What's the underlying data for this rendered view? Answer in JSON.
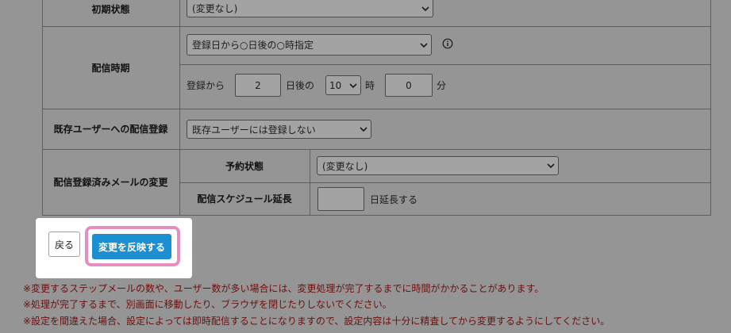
{
  "form": {
    "initial_state": {
      "label": "初期状態",
      "value": "(変更なし)"
    },
    "delivery_timing": {
      "label": "配信時期",
      "mode": "登録日から○日後の○時指定",
      "prefix": "登録から",
      "days": "2",
      "days_suffix": "日後の",
      "hour": "10",
      "hour_suffix": "時",
      "minute": "0",
      "minute_suffix": "分",
      "info_icon": "info-icon"
    },
    "existing_users": {
      "label": "既存ユーザーへの配信登録",
      "value": "既存ユーザーには登録しない"
    },
    "registered_change": {
      "label": "配信登録済みメールの変更",
      "reservation_label": "予約状態",
      "reservation_value": "(変更なし)",
      "extend_label": "配信スケジュール延長",
      "extend_value": "",
      "extend_suffix": "日延長する"
    }
  },
  "actions": {
    "back_label": "戻る",
    "apply_label": "変更を反映する"
  },
  "notes": [
    "※変更するステップメールの数や、ユーザー数が多い場合には、変更処理が完了するまでに時間がかかることがあります。",
    "※処理が完了するまで、別画面に移動したり、ブラウザを閉じたりしないでください。",
    "※設定を間違えた場合、設定によっては即時配信することになりますので、設定内容は十分に精査してから変更するようにしてください。"
  ],
  "colors": {
    "overlay_bg": "#959595",
    "apply_button": "#1b8fd0",
    "highlight_border": "#e58fc0",
    "note_text": "#6d0e0e"
  }
}
